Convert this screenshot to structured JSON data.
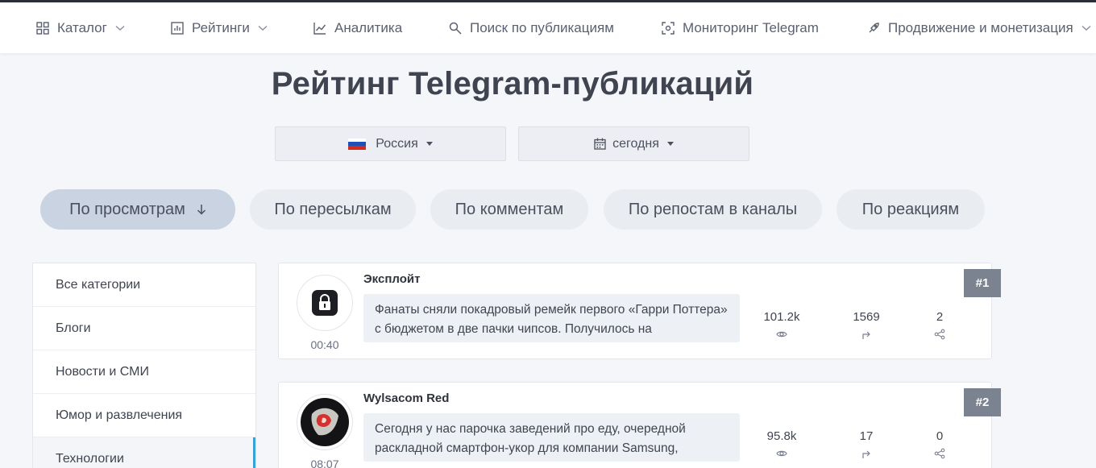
{
  "nav": {
    "catalog": "Каталог",
    "ratings": "Рейтинги",
    "analytics": "Аналитика",
    "search": "Поиск по публикациям",
    "monitoring": "Мониторинг Telegram",
    "promotion": "Продвижение и монетизация"
  },
  "page": {
    "title": "Рейтинг Telegram-публикаций"
  },
  "filters": {
    "country": "Россия",
    "period": "сегодня"
  },
  "tabs": [
    {
      "label": "По просмотрам",
      "active": true
    },
    {
      "label": "По пересылкам"
    },
    {
      "label": "По комментам"
    },
    {
      "label": "По репостам в каналы"
    },
    {
      "label": "По реакциям"
    }
  ],
  "sidebar": {
    "items": [
      {
        "label": "Все категории"
      },
      {
        "label": "Блоги"
      },
      {
        "label": "Новости и СМИ"
      },
      {
        "label": "Юмор и развлечения"
      },
      {
        "label": "Технологии",
        "active": true
      }
    ]
  },
  "posts": [
    {
      "rank": "#1",
      "channel": "Эксплойт",
      "time": "00:40",
      "text": "Фанаты сняли покадровый ремейк первого «Гарри Поттера» с бюджетом в две пачки чипсов. Получилось на",
      "views": "101.2k",
      "forwards": "1569",
      "reposts": "2"
    },
    {
      "rank": "#2",
      "channel": "Wylsacom Red",
      "time": "08:07",
      "text": "Сегодня у нас парочка заведений про еду, очередной раскладной смартфон-укор для компании Samsung,",
      "views": "95.8k",
      "forwards": "17",
      "reposts": "0"
    }
  ],
  "colors": {
    "accent": "#3aa1d8",
    "rank_badge": "#7b8290",
    "active_tab": "#c9d3e1"
  }
}
